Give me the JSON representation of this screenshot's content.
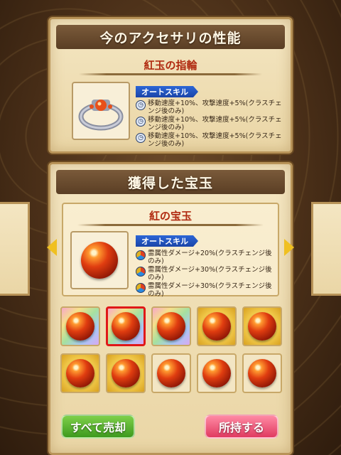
{
  "accessory": {
    "title": "今のアクセサリの性能",
    "name": "紅玉の指輪",
    "skill_tag": "オートスキル",
    "skills": [
      "移動速度+10%、攻撃速度+5%(クラスチェンジ後のみ)",
      "移動速度+10%、攻撃速度+5%(クラスチェンジ後のみ)",
      "移動速度+10%、攻撃速度+5%(クラスチェンジ後のみ)"
    ]
  },
  "gem": {
    "title": "獲得した宝玉",
    "name": "紅の宝玉",
    "skill_tag": "オートスキル",
    "skills": [
      "雷属性ダメージ+20%(クラスチェンジ後のみ)",
      "雷属性ダメージ+30%(クラスチェンジ後のみ)",
      "雷属性ダメージ+30%(クラスチェンジ後のみ)"
    ]
  },
  "gem_slots": [
    "rainbow",
    "rainbow-selected",
    "rainbow",
    "gold",
    "gold",
    "gold",
    "gold",
    "plain",
    "plain",
    "plain"
  ],
  "buttons": {
    "sell_all": "すべて売却",
    "keep": "所持する"
  },
  "colors": {
    "sell_all": "#4ea82a",
    "keep": "#e8466a",
    "accent_red": "#b02a10"
  }
}
